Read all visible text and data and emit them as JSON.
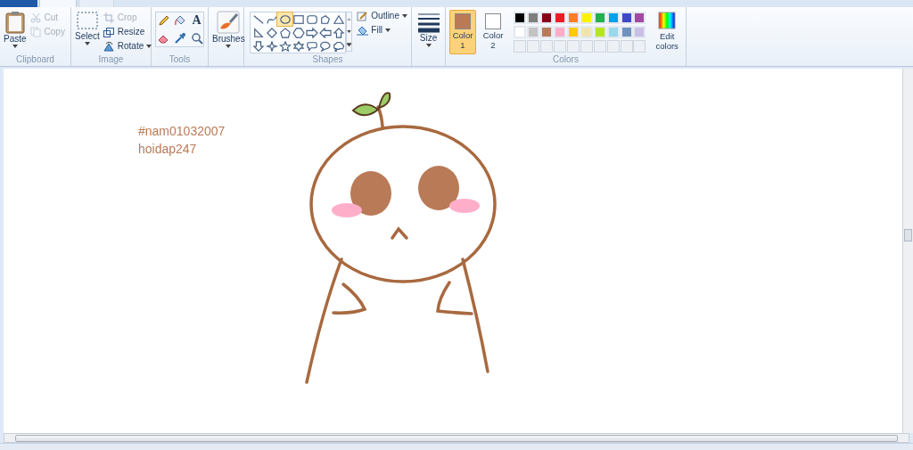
{
  "ribbon": {
    "clipboard": {
      "label": "Clipboard",
      "paste": "Paste",
      "cut": {
        "label": "Cut",
        "disabled": true
      },
      "copy": {
        "label": "Copy",
        "disabled": true
      }
    },
    "image": {
      "label": "Image",
      "select": "Select",
      "crop": {
        "label": "Crop",
        "disabled": true
      },
      "resize": {
        "label": "Resize",
        "disabled": false
      },
      "rotate": {
        "label": "Rotate",
        "disabled": false
      }
    },
    "tools": {
      "label": "Tools",
      "text_tool": "A"
    },
    "brushes": {
      "label": "Brushes"
    },
    "shapes": {
      "label": "Shapes",
      "outline": "Outline",
      "fill": "Fill",
      "items": [
        {
          "kind": "line",
          "selected": false
        },
        {
          "kind": "curve",
          "selected": false
        },
        {
          "kind": "oval",
          "selected": true
        },
        {
          "kind": "rectangle",
          "selected": false
        },
        {
          "kind": "rounded-rectangle",
          "selected": false
        },
        {
          "kind": "polygon",
          "selected": false
        },
        {
          "kind": "triangle",
          "selected": false
        },
        {
          "kind": "right-triangle",
          "selected": false
        },
        {
          "kind": "diamond",
          "selected": false
        },
        {
          "kind": "pentagon",
          "selected": false
        },
        {
          "kind": "hexagon",
          "selected": false
        },
        {
          "kind": "right-arrow",
          "selected": false
        },
        {
          "kind": "left-arrow",
          "selected": false
        },
        {
          "kind": "up-arrow",
          "selected": false
        },
        {
          "kind": "down-arrow",
          "selected": false
        },
        {
          "kind": "four-point-star",
          "selected": false
        },
        {
          "kind": "five-point-star",
          "selected": false
        },
        {
          "kind": "six-point-star",
          "selected": false
        },
        {
          "kind": "rounded-callout",
          "selected": false
        },
        {
          "kind": "oval-callout",
          "selected": false
        },
        {
          "kind": "cloud-callout",
          "selected": false
        }
      ]
    },
    "size": {
      "label": "Size"
    },
    "colors": {
      "label": "Colors",
      "color1": {
        "label": "Color 1",
        "color": "#b97a57",
        "selected": true
      },
      "color2": {
        "label": "Color 2",
        "color": "#ffffff",
        "selected": false
      },
      "edit": "Edit colors",
      "swatches": [
        {
          "color": "#000000"
        },
        {
          "color": "#7f7f7f"
        },
        {
          "color": "#880015"
        },
        {
          "color": "#ed1c24"
        },
        {
          "color": "#ff7f27"
        },
        {
          "color": "#fff200"
        },
        {
          "color": "#22b14c"
        },
        {
          "color": "#00a2e8"
        },
        {
          "color": "#3f48cc"
        },
        {
          "color": "#a349a4"
        },
        {
          "color": "#ffffff"
        },
        {
          "color": "#c3c3c3"
        },
        {
          "color": "#b97a57"
        },
        {
          "color": "#ffaec9"
        },
        {
          "color": "#ffc90e"
        },
        {
          "color": "#efe4b0"
        },
        {
          "color": "#b5e61d"
        },
        {
          "color": "#99d9ea"
        },
        {
          "color": "#7092be"
        },
        {
          "color": "#c8bfe7"
        }
      ]
    }
  },
  "canvas": {
    "text_lines": [
      "#nam01032007",
      "hoidap247"
    ]
  }
}
